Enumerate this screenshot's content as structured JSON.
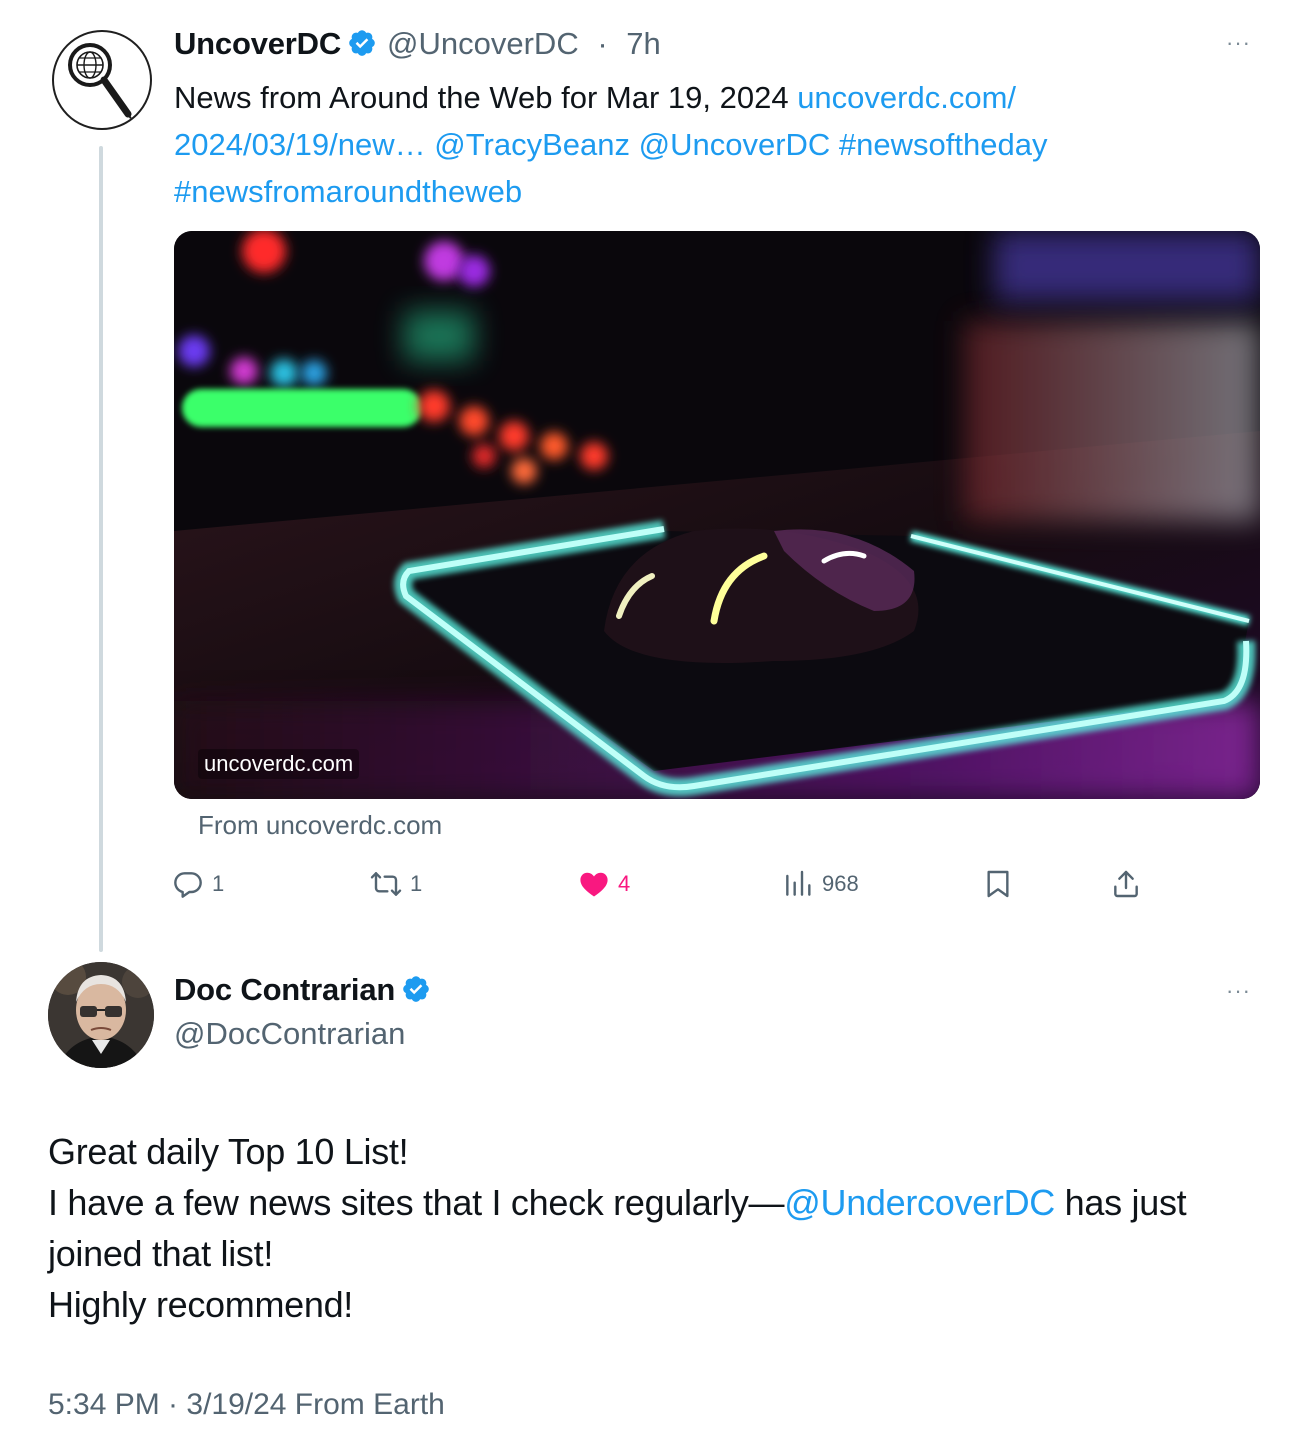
{
  "tweet1": {
    "author_name": "UncoverDC",
    "handle": "@UncoverDC",
    "time_sep": " · ",
    "time": "7h",
    "more": "···",
    "text_prefix": "News from Around the Web for Mar 19, 2024 ",
    "link": "uncoverdc.com/ 2024/03/19/new…",
    "mention1": "@TracyBeanz",
    "mention2": "@UncoverDC",
    "hashtag1": "#newsoftheday",
    "hashtag2": "#newsfromaroundtheweb",
    "card_domain": "uncoverdc.com",
    "card_from": "From uncoverdc.com",
    "actions": {
      "replies": "1",
      "retweets": "1",
      "likes": "4",
      "views": "968"
    }
  },
  "tweet2": {
    "author_name": "Doc Contrarian",
    "handle": "@DocContrarian",
    "more": "···",
    "line1": "Great daily Top 10 List!",
    "line2_prefix": "I have a few news sites that I check regularly—",
    "line2_mention": "@UndercoverDC",
    "line2_suffix": " has just joined that list!",
    "line3": "Highly recommend!",
    "timestamp": "5:34 PM · 3/19/24 From Earth"
  },
  "colors": {
    "link": "#1d9bf0",
    "secondary_text": "#536471",
    "like_active": "#f91880",
    "verified_badge": "#1d9bf0"
  },
  "icons": [
    "magnifier-globe-logo-icon",
    "verified-badge-icon",
    "reply-icon",
    "retweet-icon",
    "heart-icon",
    "views-icon",
    "bookmark-icon",
    "share-icon",
    "more-icon"
  ]
}
